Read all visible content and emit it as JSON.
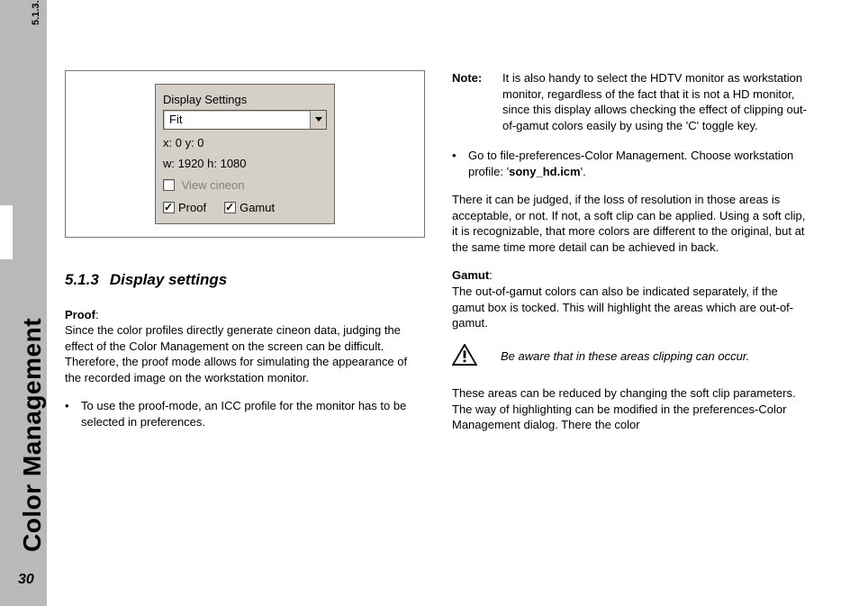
{
  "sidebar": {
    "section_ref": "5.1.3.",
    "chapter_title": "Color Management",
    "page_number": "30"
  },
  "screenshot": {
    "group_label": "Display Settings",
    "select_value": "Fit",
    "coords": "x:    0 y:    0",
    "dims": "w:   1920 h:  1080",
    "view_cineon": "View cineon",
    "proof": "Proof",
    "gamut": "Gamut"
  },
  "left": {
    "heading_num": "5.1.3",
    "heading_text": "Display settings",
    "proof_label": "Proof",
    "proof_body": "Since the color profiles directly generate cineon data, judging the effect of the Color Management on the screen can be difficult. Therefore, the proof mode allows for simulating the appearance of the recorded image on the workstation monitor.",
    "bullet1": "To use the proof-mode, an ICC profile for the monitor has to be selected in preferences."
  },
  "right": {
    "note_label": "Note",
    "note_body": "It is also handy to select the HDTV monitor as workstation monitor, regardless of the fact that it is not a HD monitor, since this display allows checking the effect of clipping out-of-gamut colors easily by using the 'C' toggle key.",
    "bullet1_pre": "Go to file-preferences-Color Management. Choose workstation profile: '",
    "bullet1_bold": "sony_hd.icm",
    "bullet1_post": "'.",
    "para1": "There it can be judged, if the loss of resolution in those areas is acceptable, or not. If not, a soft clip can be applied. Using a soft clip, it is recognizable, that more colors are different to the original, but at the same time more detail can be achieved in back.",
    "gamut_label": "Gamut",
    "gamut_body": "The out-of-gamut colors can also be indicated separately, if the gamut box is tocked. This will highlight the areas which are out-of-gamut.",
    "warn_text": "Be aware that in these areas clipping can occur.",
    "para2": "These areas can be reduced by changing the soft clip parameters. The way of highlighting can be modified in the preferences-Color Management dialog. There the color"
  }
}
